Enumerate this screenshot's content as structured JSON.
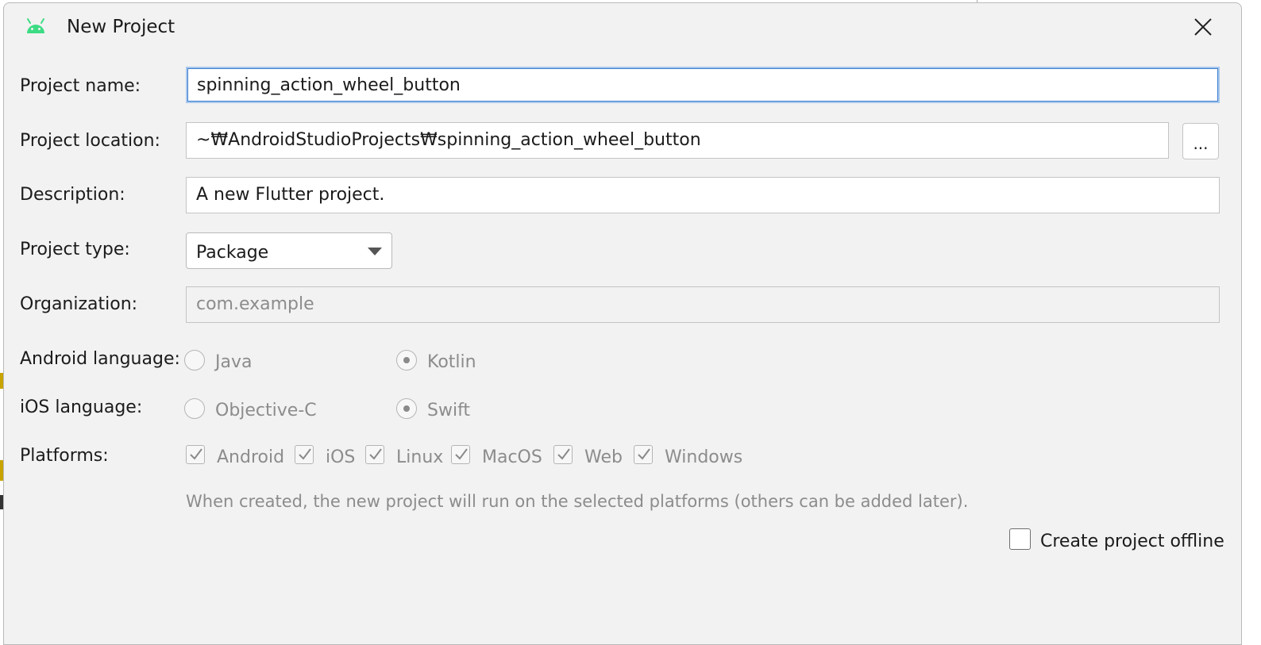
{
  "window": {
    "title": "New Project",
    "icon": "android-icon",
    "accent_color": "#3ddc84"
  },
  "form": {
    "project_name": {
      "label": "Project name:",
      "value": "spinning_action_wheel_button"
    },
    "project_location": {
      "label": "Project location:",
      "value": "~₩AndroidStudioProjects₩spinning_action_wheel_button",
      "browse_label": "..."
    },
    "description": {
      "label": "Description:",
      "value": "A new Flutter project."
    },
    "project_type": {
      "label": "Project type:",
      "value": "Package"
    },
    "organization": {
      "label": "Organization:",
      "placeholder": "com.example"
    },
    "android_language": {
      "label": "Android language:",
      "options": [
        "Java",
        "Kotlin"
      ],
      "selected": "Kotlin"
    },
    "ios_language": {
      "label": "iOS language:",
      "options": [
        "Objective-C",
        "Swift"
      ],
      "selected": "Swift"
    },
    "platforms": {
      "label": "Platforms:",
      "items": [
        "Android",
        "iOS",
        "Linux",
        "MacOS",
        "Web",
        "Windows"
      ],
      "hint": "When created, the new project will run on the selected platforms (others can be added later)."
    },
    "offline": {
      "label": "Create project offline",
      "checked": false
    }
  }
}
